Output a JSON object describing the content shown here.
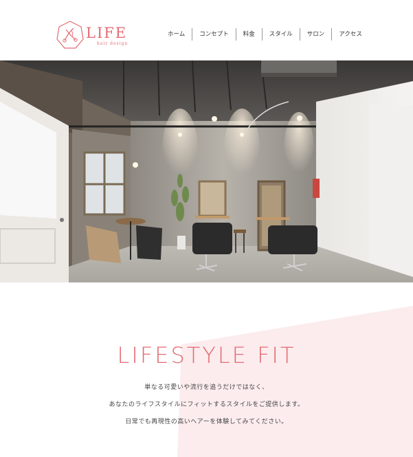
{
  "logo": {
    "word": "LIFE",
    "subtitle": "hair design"
  },
  "nav": {
    "items": [
      "ホーム",
      "コンセプト",
      "料金",
      "スタイル",
      "サロン",
      "アクセス"
    ]
  },
  "concept": {
    "headline": "LIFESTYLE FIT",
    "lines": [
      "単なる可愛いや流行を追うだけではなく、",
      "あなたのライフスタイルにフィットするスタイルをご提供します。",
      "日常でも再現性の高いヘアーを体験してみてください。"
    ]
  },
  "colors": {
    "accent": "#e36b72",
    "pink_band": "#fcecee",
    "text": "#333333"
  },
  "hero": {
    "description_icon": "salon-interior-photo"
  }
}
